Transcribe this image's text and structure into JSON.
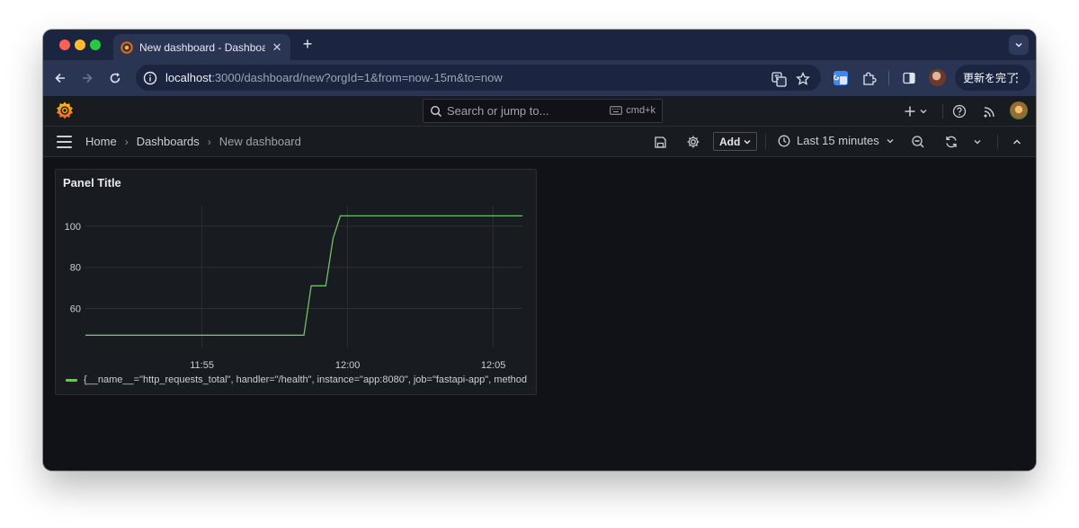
{
  "browser": {
    "tab": {
      "title": "New dashboard - Dashboards - Grafana"
    },
    "address": {
      "host": "localhost",
      "path": ":3000/dashboard/new?orgId=1&from=now-15m&to=now"
    },
    "update_button": {
      "label": "更新を完了"
    }
  },
  "grafana": {
    "search": {
      "placeholder": "Search or jump to...",
      "shortcut": "cmd+k"
    },
    "breadcrumbs": [
      "Home",
      "Dashboards",
      "New dashboard"
    ],
    "add_button": {
      "label": "Add"
    },
    "time_range": {
      "label": "Last 15 minutes"
    },
    "panel": {
      "title": "Panel Title",
      "legend": "{__name__=\"http_requests_total\", handler=\"/health\", instance=\"app:8080\", job=\"fastapi-app\", method"
    }
  },
  "colors": {
    "series": "#73bf69",
    "accent": "#f46800"
  },
  "chart_data": {
    "type": "line",
    "x_tick_labels": [
      "11:55",
      "12:00",
      "12:05"
    ],
    "y_tick_labels": [
      "60",
      "80",
      "100"
    ],
    "xlim": [
      "11:51",
      "12:06"
    ],
    "ylim": [
      41,
      110
    ],
    "grid": true,
    "series": [
      {
        "name": "{__name__=\"http_requests_total\", handler=\"/health\", instance=\"app:8080\", job=\"fastapi-app\", method",
        "points": [
          [
            "11:51",
            47
          ],
          [
            "11:58:30",
            47
          ],
          [
            "11:58:45",
            71
          ],
          [
            "11:59:15",
            71
          ],
          [
            "11:59:30",
            94
          ],
          [
            "11:59:45",
            105
          ],
          [
            "12:06",
            105
          ]
        ]
      }
    ]
  }
}
